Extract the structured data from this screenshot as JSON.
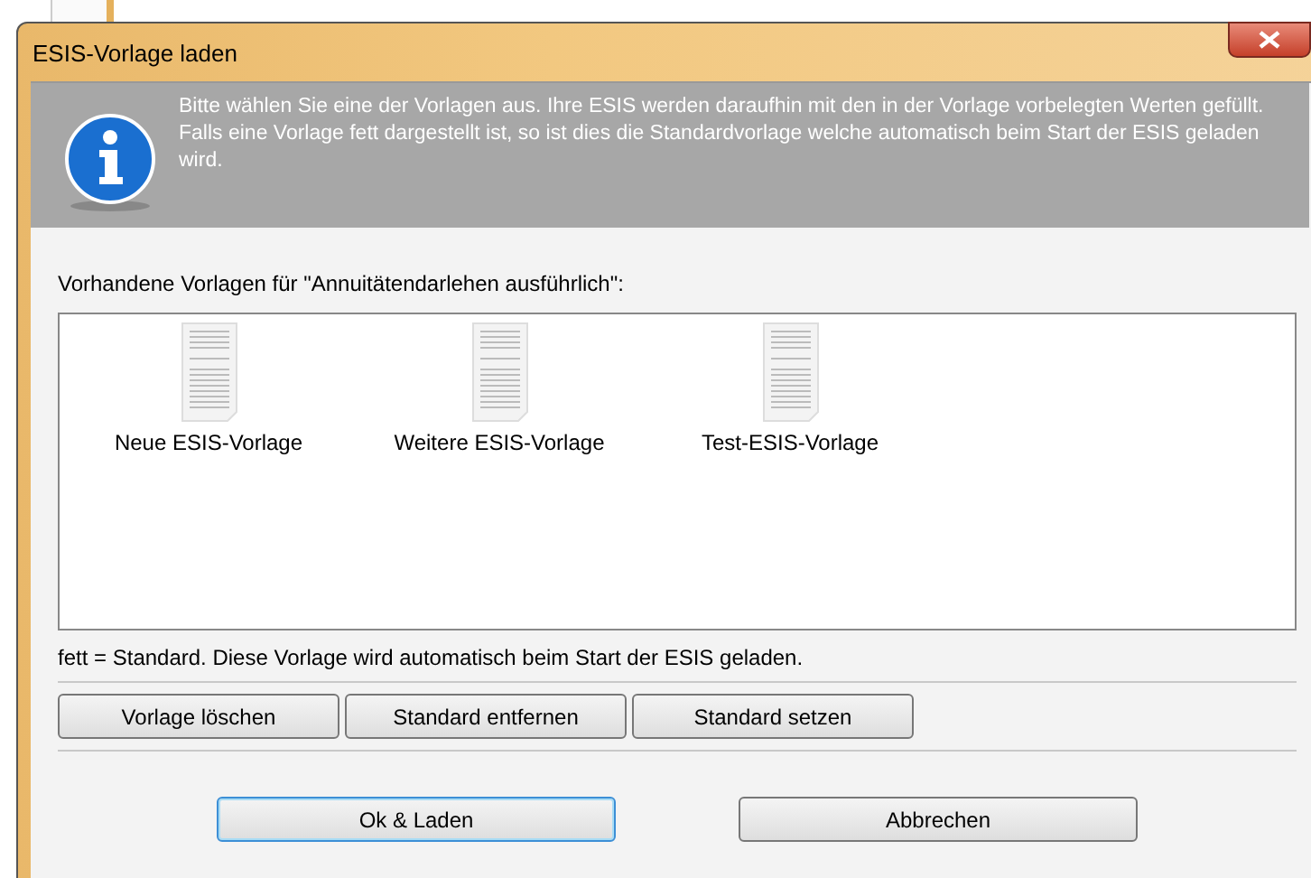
{
  "window": {
    "title": "ESIS-Vorlage laden"
  },
  "info": {
    "text": "Bitte wählen Sie eine der Vorlagen aus. Ihre ESIS werden daraufhin mit den in der Vorlage vorbelegten Werten gefüllt. Falls eine Vorlage fett dargestellt ist, so ist dies die Standardvorlage welche automatisch beim Start der ESIS geladen wird."
  },
  "list_label": "Vorhandene Vorlagen für \"Annuitätendarlehen ausführlich\":",
  "templates": [
    {
      "name": "Neue ESIS-Vorlage",
      "is_default": false,
      "selected": false
    },
    {
      "name": "Weitere ESIS-Vorlage",
      "is_default": false,
      "selected": false
    },
    {
      "name": "Test-ESIS-Vorlage",
      "is_default": false,
      "selected": false
    }
  ],
  "legend": "fett = Standard. Diese Vorlage wird automatisch beim Start der ESIS geladen.",
  "template_buttons": [
    "Vorlage löschen",
    "Standard entfernen",
    "Standard setzen"
  ],
  "dialog_buttons": [
    {
      "label": "Ok & Laden",
      "default": true
    },
    {
      "label": "Abbrechen",
      "default": false
    }
  ]
}
